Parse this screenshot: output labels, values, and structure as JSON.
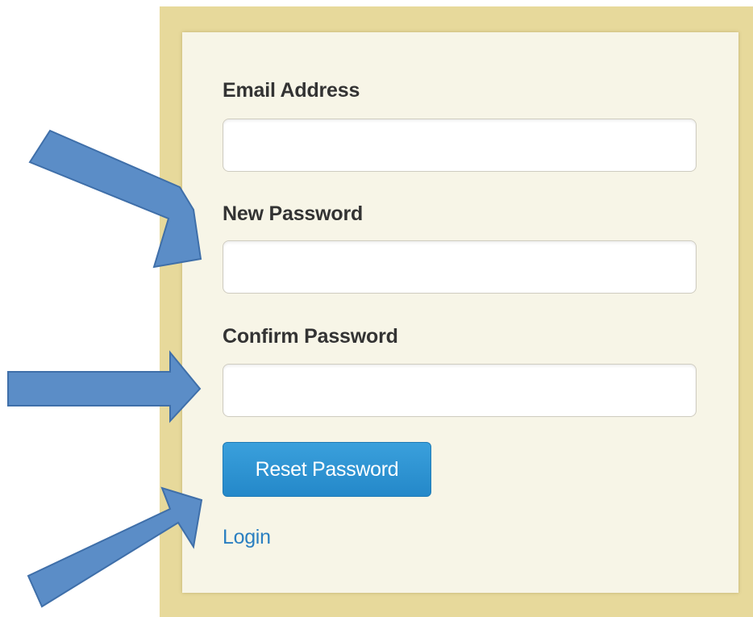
{
  "form": {
    "email_label": "Email Address",
    "email_value": "",
    "new_password_label": "New Password",
    "new_password_value": "",
    "confirm_password_label": "Confirm Password",
    "confirm_password_value": "",
    "submit_label": "Reset Password",
    "login_link": "Login"
  },
  "annotations": {
    "arrow_count": 3,
    "arrow_color": "#5b8dc7"
  },
  "colors": {
    "frame": "#e7d99b",
    "panel": "#f7f5e7",
    "button": "#2a92d3",
    "link": "#2a7fc1"
  }
}
